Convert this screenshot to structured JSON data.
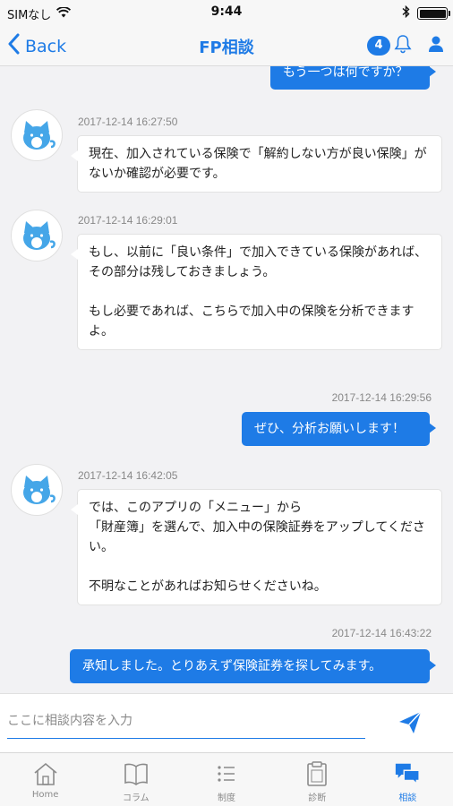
{
  "status_bar": {
    "carrier": "SIMなし",
    "time": "9:44"
  },
  "nav": {
    "back_label": "Back",
    "title": "FP相談",
    "notification_count": "4"
  },
  "messages": [
    {
      "type": "out",
      "text": "もう一つは何ですか？"
    },
    {
      "type": "in",
      "timestamp": "2017-12-14 16:27:50",
      "text": "現在、加入されている保険で「解約しない方が良い保険」がないか確認が必要です。"
    },
    {
      "type": "in",
      "timestamp": "2017-12-14 16:29:01",
      "text": "もし、以前に「良い条件」で加入できている保険があれば、\nその部分は残しておきましょう。\n\nもし必要であれば、こちらで加入中の保険を分析できますよ。"
    },
    {
      "type": "out",
      "timestamp": "2017-12-14 16:29:56",
      "text": "ぜひ、分析お願いします！"
    },
    {
      "type": "in",
      "timestamp": "2017-12-14 16:42:05",
      "text": "では、このアプリの「メニュー」から\n「財産簿」を選んで、加入中の保険証券をアップしてください。\n\n不明なことがあればお知らせくださいね。"
    },
    {
      "type": "out",
      "timestamp": "2017-12-14 16:43:22",
      "text": "承知しました。とりあえず保険証券を探してみます。"
    }
  ],
  "input": {
    "placeholder": "ここに相談内容を入力"
  },
  "tabs": [
    {
      "label": "Home",
      "icon": "home-icon"
    },
    {
      "label": "コラム",
      "icon": "book-icon"
    },
    {
      "label": "制度",
      "icon": "list-icon"
    },
    {
      "label": "診断",
      "icon": "clipboard-icon"
    },
    {
      "label": "相談",
      "icon": "chat-icon",
      "active": true
    }
  ],
  "colors": {
    "accent": "#1e7be6",
    "background": "#f2f2f4"
  }
}
